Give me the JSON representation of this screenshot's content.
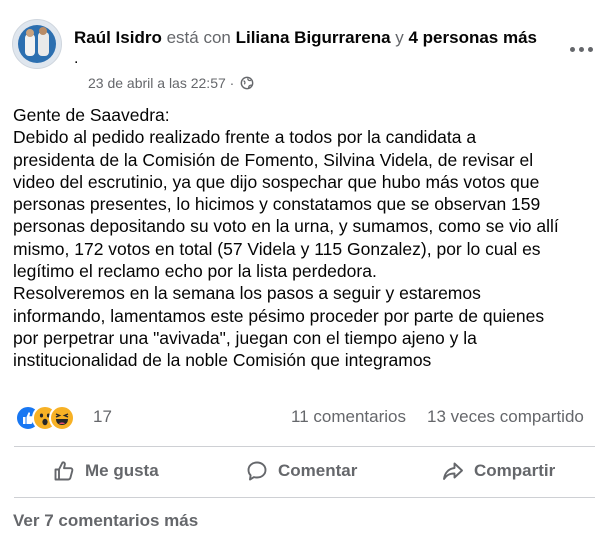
{
  "post": {
    "author": "Raúl Isidro",
    "with_text": "está con",
    "tagged": "Liliana Bigurrarena",
    "and_text": "y",
    "others": "4 personas más",
    "trailing": ".",
    "timestamp": "23 de abril a las 22:57",
    "separator": "·",
    "privacy_icon": "globe-icon",
    "body": "Gente de Saavedra:\nDebido al pedido realizado frente a todos por la candidata a\npresidenta de la Comisión de Fomento, Silvina Videla, de revisar el\nvideo del escrutinio, ya que dijo sospechar que hubo más votos que\npersonas presentes, lo hicimos y constatamos que se observan 159\npersonas depositando su voto en la urna, y sumamos, como se vio allí\nmismo, 172 votos en total (57 Videla y 115 Gonzalez), por lo cual es\nlegítimo el reclamo echo por la lista perdedora.\nResolveremos en la semana los pasos a seguir y estaremos\ninformando, lamentamos este pésimo proceder por parte de quienes\npor perpetrar una \"avivada\", juegan con el tiempo ajeno y la\ninstitucionalidad de la noble  Comisión que integramos"
  },
  "stats": {
    "reaction_icons": [
      "like-icon",
      "wow-icon",
      "haha-icon"
    ],
    "reaction_count": "17",
    "comments": "11 comentarios",
    "shares": "13 veces compartido"
  },
  "actions": {
    "like": "Me gusta",
    "comment": "Comentar",
    "share": "Compartir"
  },
  "footer": {
    "view_more": "Ver 7 comentarios más"
  },
  "colors": {
    "text": "#050505",
    "muted": "#65676b",
    "like_blue": "#1877f2",
    "emoji_yellow": "#f7b125",
    "divider": "#ced0d4"
  }
}
